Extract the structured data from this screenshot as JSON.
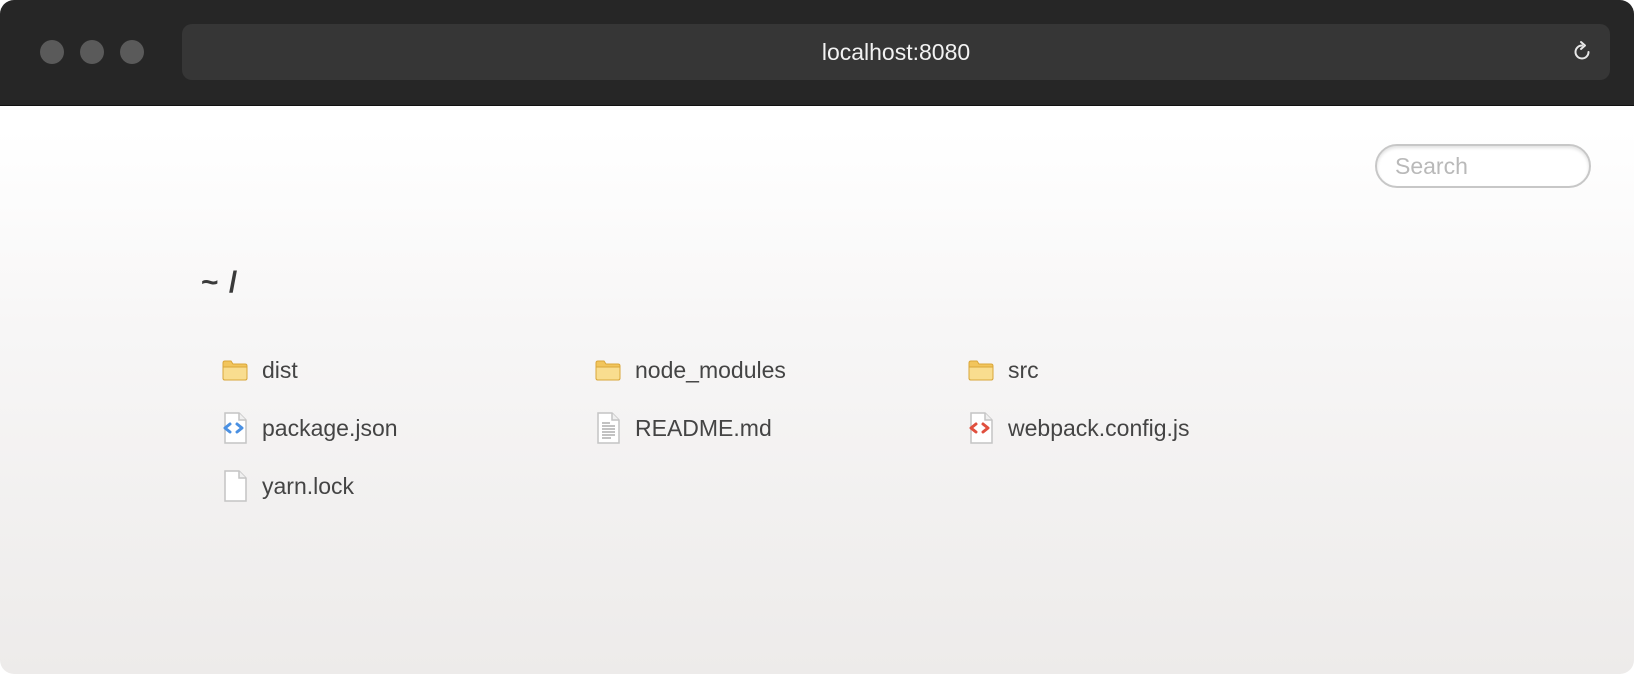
{
  "browser": {
    "url": "localhost:8080",
    "reload_icon": "reload-icon"
  },
  "search": {
    "placeholder": "Search",
    "value": ""
  },
  "heading": "~ /",
  "files": [
    {
      "name": "dist",
      "icon": "folder-icon",
      "type": "folder"
    },
    {
      "name": "node_modules",
      "icon": "folder-icon",
      "type": "folder"
    },
    {
      "name": "src",
      "icon": "folder-icon",
      "type": "folder"
    },
    {
      "name": "package.json",
      "icon": "json-file-icon",
      "type": "file"
    },
    {
      "name": "README.md",
      "icon": "text-file-icon",
      "type": "file"
    },
    {
      "name": "webpack.config.js",
      "icon": "js-file-icon",
      "type": "file"
    },
    {
      "name": "yarn.lock",
      "icon": "blank-file-icon",
      "type": "file"
    }
  ],
  "colors": {
    "titlebar": "#262626",
    "urlbar": "#363636",
    "folder": "#f2c55c",
    "json_accent": "#4a90e2",
    "js_accent": "#e0503e",
    "text": "#444444"
  }
}
